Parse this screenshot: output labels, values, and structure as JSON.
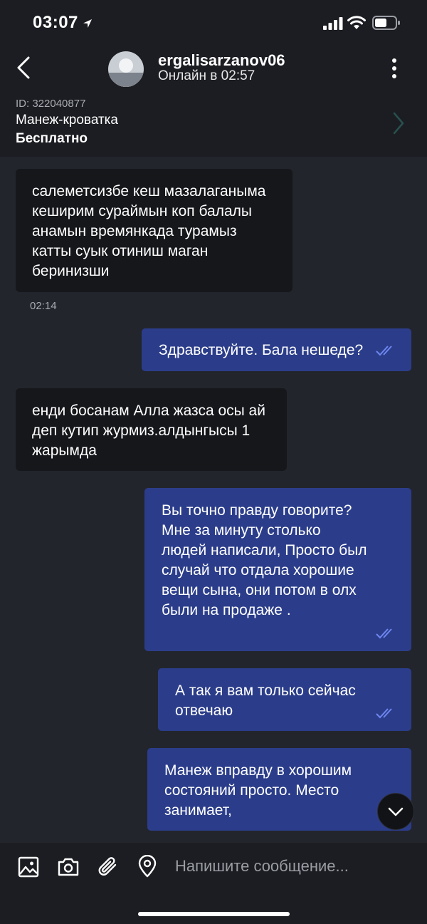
{
  "status_bar": {
    "time": "03:07"
  },
  "header": {
    "username": "ergalisarzanov06",
    "online_status": "Онлайн в 02:57"
  },
  "ad": {
    "id_text": "ID: 322040877",
    "title": "Манеж-кроватка",
    "price": "Бесплатно"
  },
  "messages": [
    {
      "direction": "incoming",
      "text": "салеметсизбе кеш мазалаганыма кеширим сураймын  коп балалы анамын времянкада турамыз катты суык отиниш маган беринизши",
      "time": "02:14"
    },
    {
      "direction": "outgoing",
      "text": "Здравствуйте. Бала нешеде?"
    },
    {
      "direction": "incoming",
      "text": "енди босанам Алла жазса  осы ай  деп кутип журмиз.алдынгысы 1 жарымда"
    },
    {
      "direction": "outgoing",
      "text": "Вы точно правду говорите? Мне за минуту столько людей написали, Просто был случай что отдала хорошие вещи сына, они потом в олх были на продаже ."
    },
    {
      "direction": "outgoing",
      "text": "А так я вам только сейчас отвечаю"
    },
    {
      "direction": "outgoing",
      "text": "Манеж вправду в хорошим состояний просто. Место занимает,"
    }
  ],
  "composer": {
    "placeholder": "Напишите сообщение..."
  },
  "colors": {
    "background": "#23252d",
    "incoming_bubble": "#16171b",
    "outgoing_bubble": "#2b3d8a",
    "read_ticks": "#6d86f0"
  }
}
